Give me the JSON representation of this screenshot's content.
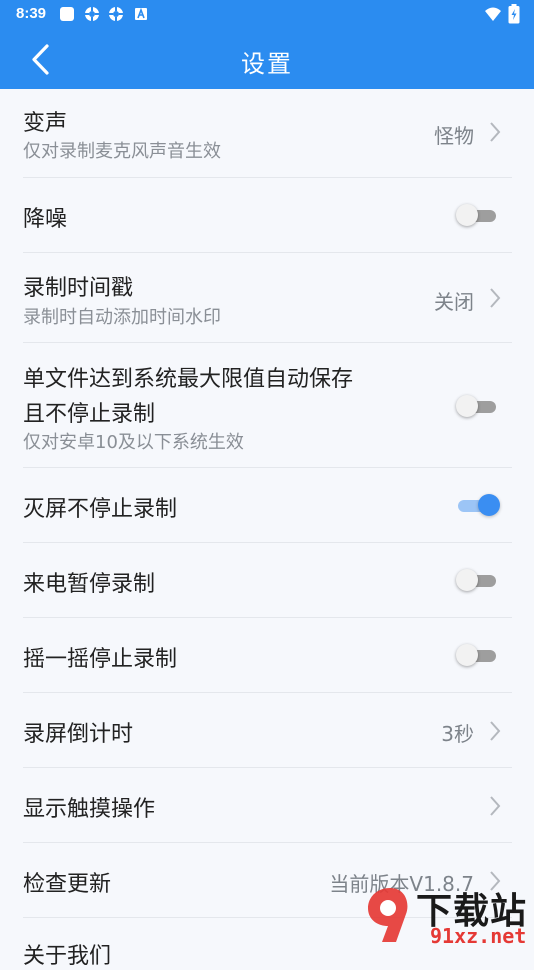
{
  "status_bar": {
    "time": "8:39",
    "icons": [
      "square-notification-icon",
      "gear-notification-icon",
      "gear-notification-icon",
      "a-box-notification-icon",
      "wifi-icon",
      "battery-charging-icon"
    ]
  },
  "header": {
    "title": "设置",
    "back_icon": "chevron-left-icon"
  },
  "settings": [
    {
      "label": "变声",
      "sub": "仅对录制麦克风声音生效",
      "value": "怪物",
      "control": "chevron"
    },
    {
      "label": "降噪",
      "control": "toggle",
      "on": false
    },
    {
      "label": "录制时间戳",
      "sub": "录制时自动添加时间水印",
      "value": "关闭",
      "control": "chevron"
    },
    {
      "label": "单文件达到系统最大限值自动保存",
      "label2": "且不停止录制",
      "sub": "仅对安卓10及以下系统生效",
      "control": "toggle",
      "on": false
    },
    {
      "label": "灭屏不停止录制",
      "control": "toggle",
      "on": true
    },
    {
      "label": "来电暂停录制",
      "control": "toggle",
      "on": false
    },
    {
      "label": "摇一摇停止录制",
      "control": "toggle",
      "on": false
    },
    {
      "label": "录屏倒计时",
      "value": "3秒",
      "control": "chevron"
    },
    {
      "label": "显示触摸操作",
      "control": "chevron"
    },
    {
      "label": "检查更新",
      "value": "当前版本V1.8.7",
      "control": "chevron"
    },
    {
      "label": "关于我们"
    }
  ],
  "watermark": {
    "brand": "下载站",
    "site": "91xz.net"
  },
  "colors": {
    "accent": "#2b8cf0",
    "toggle_on": "#3a8ef2",
    "background": "#f6f8fc"
  }
}
